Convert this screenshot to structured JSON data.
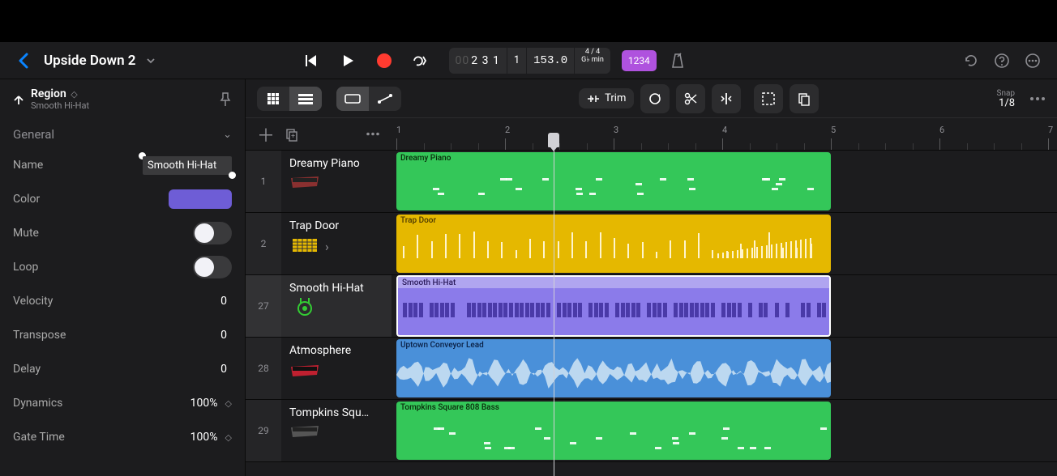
{
  "project": {
    "title": "Upside Down 2"
  },
  "transport": {
    "position_dim": "00",
    "position_main": "2 3 1",
    "beats": "1",
    "tempo": "153.0",
    "sig_top": "4 / 4",
    "sig_bot": "G♭ min",
    "quant_label": "1234"
  },
  "inspector": {
    "header_title": "Region",
    "header_sub": "Smooth Hi-Hat",
    "section": "General",
    "name_label": "Name",
    "name_value": "Smooth Hi-Hat",
    "color_label": "Color",
    "mute_label": "Mute",
    "loop_label": "Loop",
    "velocity_label": "Velocity",
    "velocity_value": "0",
    "transpose_label": "Transpose",
    "transpose_value": "0",
    "delay_label": "Delay",
    "delay_value": "0",
    "dynamics_label": "Dynamics",
    "dynamics_value": "100%",
    "gate_label": "Gate Time",
    "gate_value": "100%"
  },
  "arrange": {
    "trim_label": "Trim",
    "snap_label": "Snap",
    "snap_value": "1/8",
    "bars": [
      "1",
      "2",
      "3",
      "4",
      "5",
      "6",
      "7"
    ]
  },
  "tracks": [
    {
      "num": "1",
      "name": "Dreamy Piano",
      "region_label": "Dreamy Piano",
      "color": "green"
    },
    {
      "num": "2",
      "name": "Trap Door",
      "region_label": "Trap Door",
      "color": "yellow"
    },
    {
      "num": "27",
      "name": "Smooth Hi-Hat",
      "region_label": "Smooth Hi-Hat",
      "color": "purple"
    },
    {
      "num": "28",
      "name": "Atmosphere",
      "region_label": "Uptown Conveyor Lead",
      "color": "blue"
    },
    {
      "num": "29",
      "name": "Tompkins Squ…",
      "region_label": "Tompkins Square 808 Bass",
      "color": "green"
    }
  ]
}
